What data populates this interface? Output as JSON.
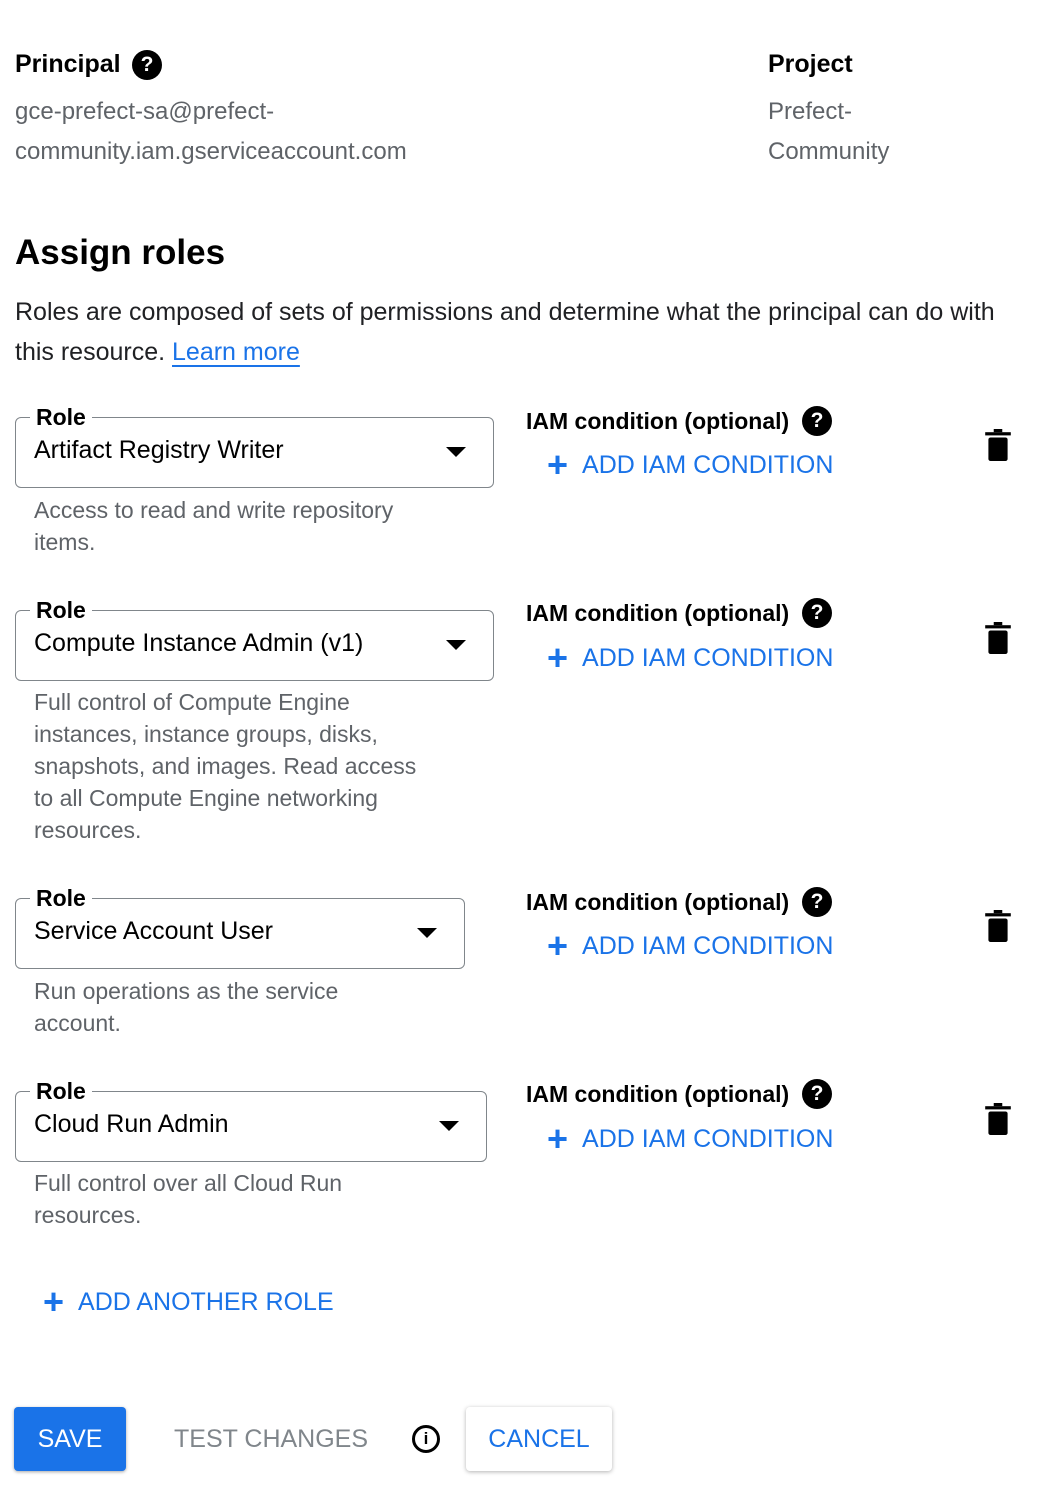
{
  "principal": {
    "label": "Principal",
    "value_line1": "gce-prefect-sa@prefect-",
    "value_line2": "community.iam.gserviceaccount.com"
  },
  "project": {
    "label": "Project",
    "value_line1": "Prefect-",
    "value_line2": "Community"
  },
  "assign": {
    "title": "Assign roles",
    "intro": "Roles are composed of sets of permissions and determine what the principal can do with this resource. ",
    "learn_more": "Learn more"
  },
  "roles": [
    {
      "legend": "Role",
      "value": "Artifact Registry Writer",
      "description_lines": [
        "Access to read and write repository",
        "items."
      ],
      "condition_label": "IAM condition (optional)",
      "add_condition": "ADD IAM CONDITION"
    },
    {
      "legend": "Role",
      "value": "Compute Instance Admin (v1)",
      "description_lines": [
        "Full control of Compute Engine",
        "instances, instance groups, disks,",
        "snapshots, and images. Read access",
        "to all Compute Engine networking",
        "resources."
      ],
      "condition_label": "IAM condition (optional)",
      "add_condition": "ADD IAM CONDITION"
    },
    {
      "legend": "Role",
      "value": "Service Account User",
      "description_lines": [
        "Run operations as the service",
        "account."
      ],
      "condition_label": "IAM condition (optional)",
      "add_condition": "ADD IAM CONDITION"
    },
    {
      "legend": "Role",
      "value": "Cloud Run Admin",
      "description_lines": [
        "Full control over all Cloud Run",
        "resources."
      ],
      "condition_label": "IAM condition (optional)",
      "add_condition": "ADD IAM CONDITION"
    }
  ],
  "add_another_role": "ADD ANOTHER ROLE",
  "actions": {
    "save": "SAVE",
    "test_changes": "TEST CHANGES",
    "cancel": "CANCEL"
  },
  "icons": {
    "help": "help-icon",
    "add": "plus-icon",
    "delete": "trash-icon",
    "info": "info-icon"
  },
  "colors": {
    "accent": "#1a73e8",
    "text": "#202124",
    "secondary_text": "#5f6368",
    "border": "#80868b"
  }
}
